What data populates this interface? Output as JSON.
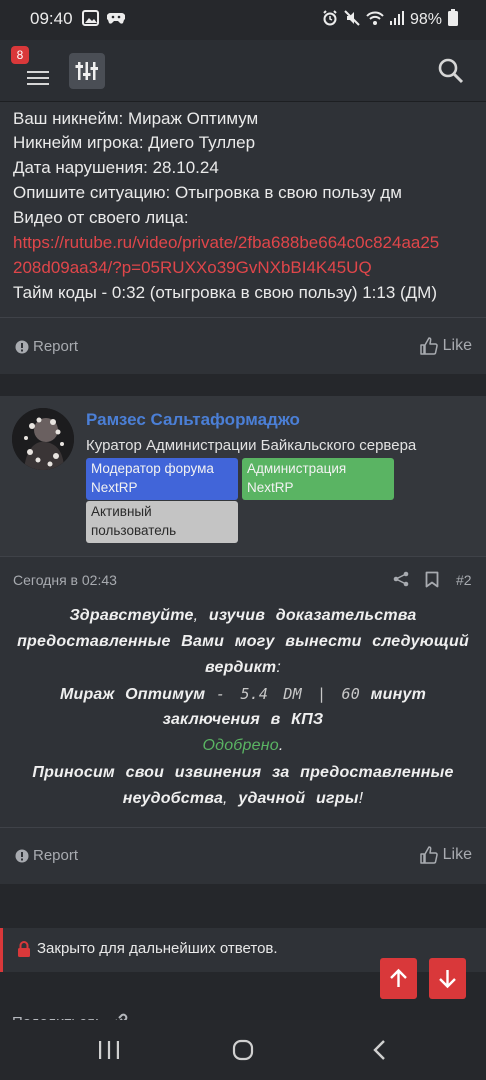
{
  "status": {
    "time": "09:40",
    "battery": "98%",
    "icons": [
      "image-icon",
      "game-icon",
      "alarm-icon",
      "mute-icon",
      "wifi-icon",
      "signal-icon",
      "battery-icon"
    ]
  },
  "header": {
    "notification_count": "8",
    "icons": [
      "menu-icon",
      "forum-logo",
      "search-icon"
    ]
  },
  "post1": {
    "lines": [
      "Ваш никнейм: Мираж Оптимум",
      "Никнейм игрока: Диего Туллер",
      "Дата нарушения: 28.10.24",
      "Опишите ситуацию: Отыгровка в свою пользу дм",
      "Видео от своего лица:"
    ],
    "link_line1": "https://rutube.ru/video/private/2fba688be664c0c824aa25",
    "link_line2": "208d09aa34/?p=05RUXXo39GvNXbBI4K45UQ",
    "timecodes": "Тайм коды - 0:32 (отыгровка в свою пользу) 1:13 (ДМ)",
    "report_label": "Report",
    "like_label": "Like"
  },
  "post2": {
    "username": "Рамзес Сальтаформаджо",
    "user_title": "Куратор Администрации Байкальского сервера",
    "badges": {
      "moderator": [
        "Модератор форума",
        "NextRP"
      ],
      "administration": [
        "Администрация",
        "NextRP"
      ],
      "active": [
        "Активный",
        "пользователь"
      ]
    },
    "date": "Сегодня в 02:43",
    "post_number": "#2",
    "message": {
      "line1_a": "Здравствуйте",
      "line1_b": ",",
      "line1_c": "изучив доказательства",
      "line2": "предоставленные Вами могу вынести следующий",
      "line3_a": "вердикт",
      "line3_b": ":",
      "line4_name": "Мираж Оптимум",
      "line4_penalty": "- 5.4 DM | 60",
      "line4_unit": "минут",
      "line5": "заключения в КПЗ",
      "line6_status": "Одобрено",
      "line6_dot": ".",
      "line7": "Приносим свои извинения за предоставленные",
      "line8_a": "неудобства",
      "line8_b": ",",
      "line8_c": "удачной игры",
      "line8_d": "!"
    },
    "report_label": "Report",
    "like_label": "Like"
  },
  "footer": {
    "closed_text": "Закрыто для дальнейших ответов.",
    "share_label": "Поделиться:"
  },
  "colors": {
    "background": "#25272b",
    "card": "#2f3237",
    "accent_red": "#d9383a",
    "link_red": "#e0464a",
    "username_blue": "#4b7fd6",
    "badge_blue": "#4165d9",
    "badge_green": "#5ab463",
    "badge_gray": "#c4c4c4"
  }
}
